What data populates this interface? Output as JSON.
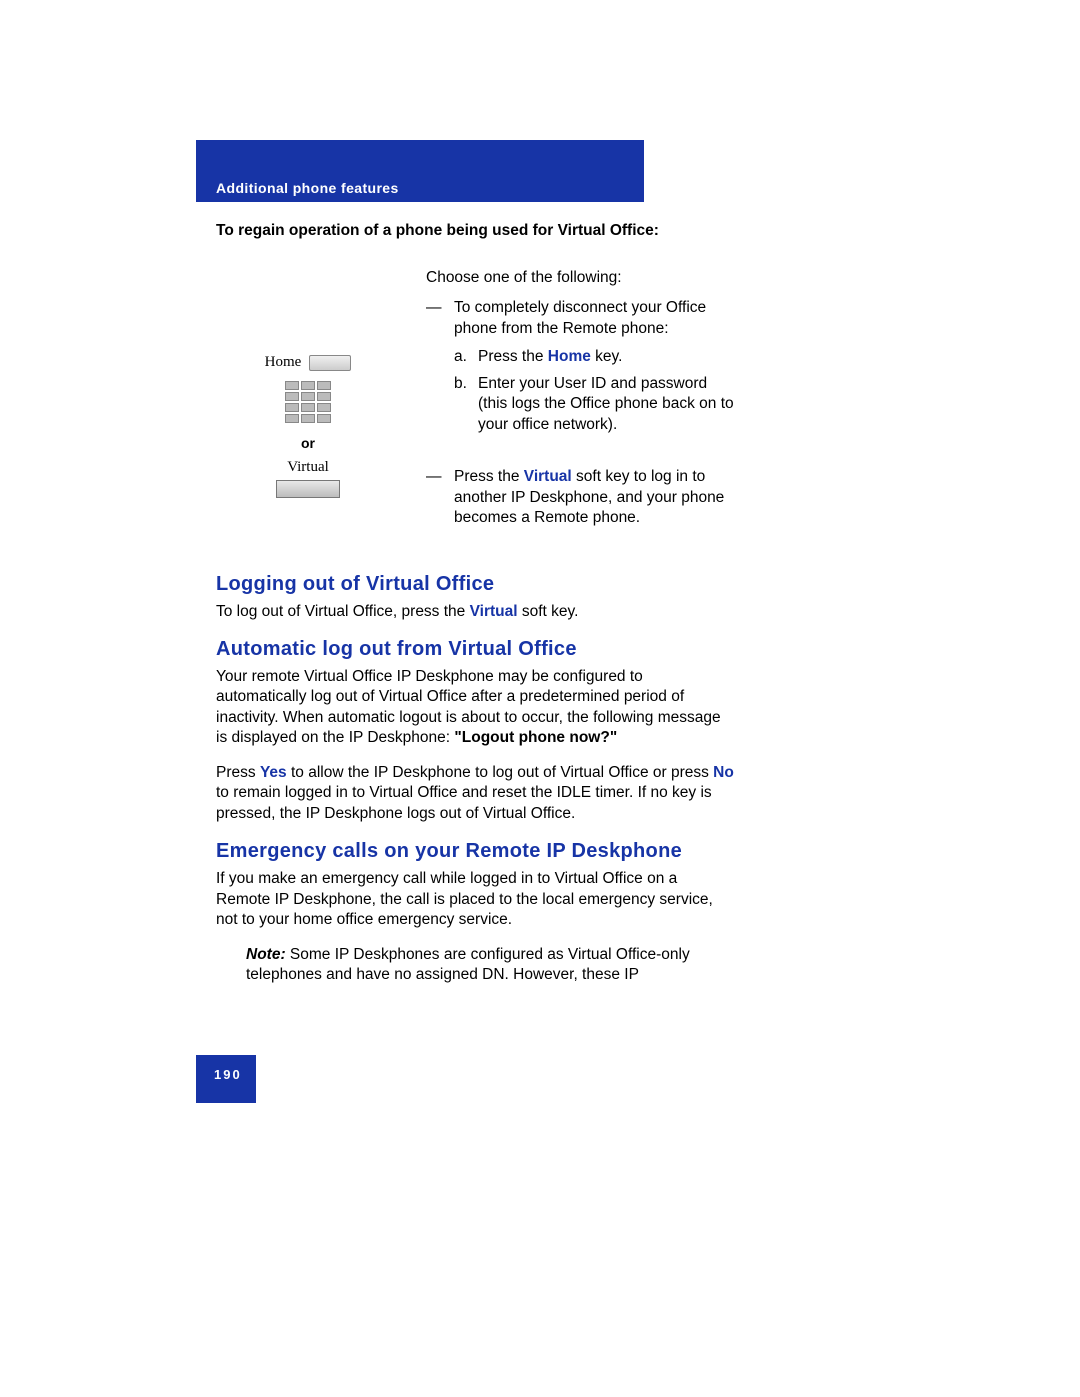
{
  "header": {
    "section_label": "Additional phone features"
  },
  "regain": {
    "title": "To regain operation of a phone being used for Virtual Office:",
    "intro": "Choose one of the following:",
    "opt1_intro": "To completely disconnect your Office phone from the Remote phone:",
    "opt1_a_pre": "Press the ",
    "opt1_a_key": "Home",
    "opt1_a_post": " key.",
    "opt1_b": "Enter your User ID and password (this logs the Office phone back on to your office network).",
    "opt2_pre": "Press the ",
    "opt2_key": "Virtual",
    "opt2_post": " soft key to log in to another IP Deskphone, and your phone becomes a Remote phone.",
    "left": {
      "home": "Home",
      "or": "or",
      "virtual": "Virtual"
    }
  },
  "logging_out": {
    "heading": "Logging out of Virtual Office",
    "p_pre": "To log out of Virtual Office, press the ",
    "p_key": "Virtual",
    "p_post": " soft key."
  },
  "auto_logout": {
    "heading": "Automatic log out from Virtual Office",
    "p1_pre": "Your remote Virtual Office IP Deskphone may be configured to automatically log out of Virtual Office after a predetermined period of inactivity. When automatic logout is about to occur, the following message is displayed on the IP Deskphone: ",
    "p1_bold": "\"Logout phone now?\"",
    "p2_pre": "Press ",
    "p2_yes": "Yes",
    "p2_mid": " to allow the IP Deskphone to log out of Virtual Office or press ",
    "p2_no": "No",
    "p2_post": " to remain logged in to Virtual Office and reset the IDLE timer. If no key is pressed, the IP Deskphone logs out of Virtual Office."
  },
  "emergency": {
    "heading": "Emergency calls on your Remote IP Deskphone",
    "p1": "If you make an emergency call while logged in to Virtual Office on a Remote IP Deskphone, the call is placed to the local emergency service, not to your home office emergency service.",
    "note_label": "Note:",
    "note_text": " Some IP Deskphones are configured as Virtual Office-only telephones and have no assigned DN. However, these IP"
  },
  "footer": {
    "page": "190"
  }
}
